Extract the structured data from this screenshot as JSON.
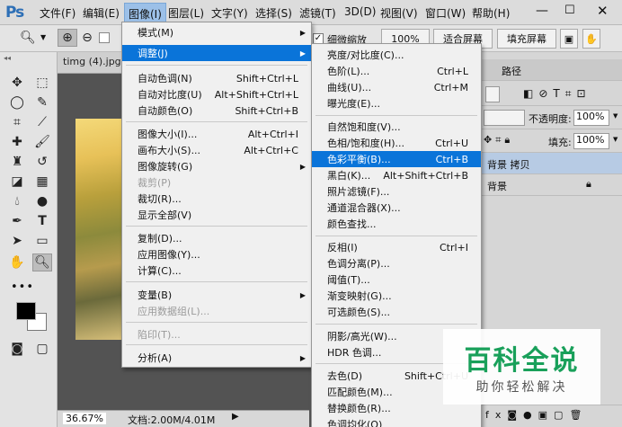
{
  "app": {
    "logo": "Ps"
  },
  "menubar": {
    "items": [
      "文件(F)",
      "编辑(E)",
      "图像(I)",
      "图层(L)",
      "文字(Y)",
      "选择(S)",
      "滤镜(T)",
      "3D(D)",
      "视图(V)",
      "窗口(W)",
      "帮助(H)"
    ]
  },
  "options": {
    "zoom_check": "细微缩放",
    "btn_100": "100%",
    "btn_fit": "适合屏幕",
    "btn_fill": "填充屏幕"
  },
  "document": {
    "tab": "timg (4).jpg",
    "zoom": "36.67%",
    "docinfo": "文档:2.00M/4.01M"
  },
  "panels": {
    "tab_path": "路径",
    "opacity_label": "不透明度:",
    "opacity_value": "100%",
    "fill_label": "填充:",
    "fill_value": "100%",
    "layers": [
      {
        "name": "背景 拷贝"
      },
      {
        "name": "背景"
      }
    ]
  },
  "image_menu": {
    "items": [
      {
        "label": "模式(M)",
        "shortcut": "",
        "submenu": true,
        "disabled": false
      },
      {
        "label": "调整(J)",
        "shortcut": "",
        "submenu": true,
        "disabled": false,
        "highlighted": true
      },
      {
        "label": "自动色调(N)",
        "shortcut": "Shift+Ctrl+L"
      },
      {
        "label": "自动对比度(U)",
        "shortcut": "Alt+Shift+Ctrl+L"
      },
      {
        "label": "自动颜色(O)",
        "shortcut": "Shift+Ctrl+B"
      },
      {
        "label": "图像大小(I)...",
        "shortcut": "Alt+Ctrl+I"
      },
      {
        "label": "画布大小(S)...",
        "shortcut": "Alt+Ctrl+C"
      },
      {
        "label": "图像旋转(G)",
        "shortcut": "",
        "submenu": true
      },
      {
        "label": "裁剪(P)",
        "shortcut": "",
        "disabled": true
      },
      {
        "label": "裁切(R)...",
        "shortcut": ""
      },
      {
        "label": "显示全部(V)",
        "shortcut": ""
      },
      {
        "label": "复制(D)...",
        "shortcut": ""
      },
      {
        "label": "应用图像(Y)...",
        "shortcut": ""
      },
      {
        "label": "计算(C)...",
        "shortcut": ""
      },
      {
        "label": "变量(B)",
        "shortcut": "",
        "submenu": true
      },
      {
        "label": "应用数据组(L)...",
        "shortcut": "",
        "disabled": true
      },
      {
        "label": "陷印(T)...",
        "shortcut": "",
        "disabled": true
      },
      {
        "label": "分析(A)",
        "shortcut": "",
        "submenu": true
      }
    ]
  },
  "adjust_menu": {
    "items": [
      {
        "label": "亮度/对比度(C)...",
        "shortcut": ""
      },
      {
        "label": "色阶(L)...",
        "shortcut": "Ctrl+L"
      },
      {
        "label": "曲线(U)...",
        "shortcut": "Ctrl+M"
      },
      {
        "label": "曝光度(E)...",
        "shortcut": ""
      },
      {
        "label": "自然饱和度(V)...",
        "shortcut": ""
      },
      {
        "label": "色相/饱和度(H)...",
        "shortcut": "Ctrl+U"
      },
      {
        "label": "色彩平衡(B)...",
        "shortcut": "Ctrl+B",
        "highlighted": true
      },
      {
        "label": "黑白(K)...",
        "shortcut": "Alt+Shift+Ctrl+B"
      },
      {
        "label": "照片滤镜(F)...",
        "shortcut": ""
      },
      {
        "label": "通道混合器(X)...",
        "shortcut": ""
      },
      {
        "label": "颜色查找...",
        "shortcut": ""
      },
      {
        "label": "反相(I)",
        "shortcut": "Ctrl+I"
      },
      {
        "label": "色调分离(P)...",
        "shortcut": ""
      },
      {
        "label": "阈值(T)...",
        "shortcut": ""
      },
      {
        "label": "渐变映射(G)...",
        "shortcut": ""
      },
      {
        "label": "可选颜色(S)...",
        "shortcut": ""
      },
      {
        "label": "阴影/高光(W)...",
        "shortcut": ""
      },
      {
        "label": "HDR 色调...",
        "shortcut": ""
      },
      {
        "label": "去色(D)",
        "shortcut": "Shift+Ctrl+U"
      },
      {
        "label": "匹配颜色(M)...",
        "shortcut": ""
      },
      {
        "label": "替换颜色(R)...",
        "shortcut": ""
      },
      {
        "label": "色调均化(Q)",
        "shortcut": ""
      }
    ]
  },
  "watermark": {
    "title": "百科全说",
    "subtitle": "助你轻松解决"
  }
}
